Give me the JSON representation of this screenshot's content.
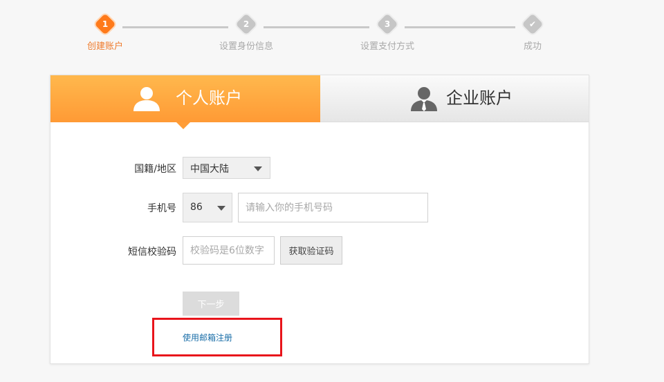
{
  "steps": [
    {
      "number": "1",
      "label": "创建账户",
      "active": true
    },
    {
      "number": "2",
      "label": "设置身份信息",
      "active": false
    },
    {
      "number": "3",
      "label": "设置支付方式",
      "active": false
    },
    {
      "number": "✔",
      "label": "成功",
      "active": false
    }
  ],
  "tabs": {
    "personal": {
      "label": "个人账户",
      "icon": "user-icon",
      "selected": true
    },
    "enterprise": {
      "label": "企业账户",
      "icon": "business-user-icon",
      "selected": false
    }
  },
  "form": {
    "nationality": {
      "label": "国籍/地区",
      "value": "中国大陆"
    },
    "phone": {
      "label": "手机号",
      "code": "86",
      "placeholder": "请输入你的手机号码"
    },
    "sms": {
      "label": "短信校验码",
      "placeholder": "校验码是6位数字",
      "button": "获取验证码"
    },
    "next_button": "下一步",
    "email_link": "使用邮箱注册"
  },
  "colors": {
    "accent": "#ff9a35",
    "step_active": "#ff7a1a",
    "link": "#1a6ea8",
    "highlight": "#e8141b"
  }
}
